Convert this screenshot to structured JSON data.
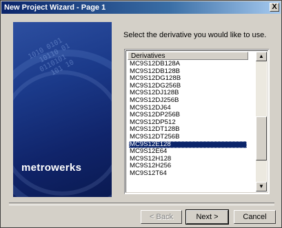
{
  "window": {
    "title": "New Project Wizard - Page  1",
    "close_glyph": "X"
  },
  "banner": {
    "logo_text": "metrowerks",
    "decor_digits": "1010 0101\n  10110 01\n 0110101\n   101 10"
  },
  "prompt": "Select the derivative you would like to use.",
  "list": {
    "header": "Derivatives",
    "items": [
      "MC9S12DB128A",
      "MC9S12DB128B",
      "MC9S12DG128B",
      "MC9S12DG256B",
      "MC9S12DJ128B",
      "MC9S12DJ256B",
      "MC9S12DJ64",
      "MC9S12DP256B",
      "MC9S12DP512",
      "MC9S12DT128B",
      "MC9S12DT256B",
      "MC9S12E128",
      "MC9S12E64",
      "MC9S12H128",
      "MC9S12H256",
      "MC9S12T64"
    ],
    "selected": "MC9S12E128"
  },
  "buttons": {
    "back": "< Back",
    "next": "Next >",
    "cancel": "Cancel"
  },
  "scrollbar": {
    "up_glyph": "▲",
    "down_glyph": "▼"
  }
}
